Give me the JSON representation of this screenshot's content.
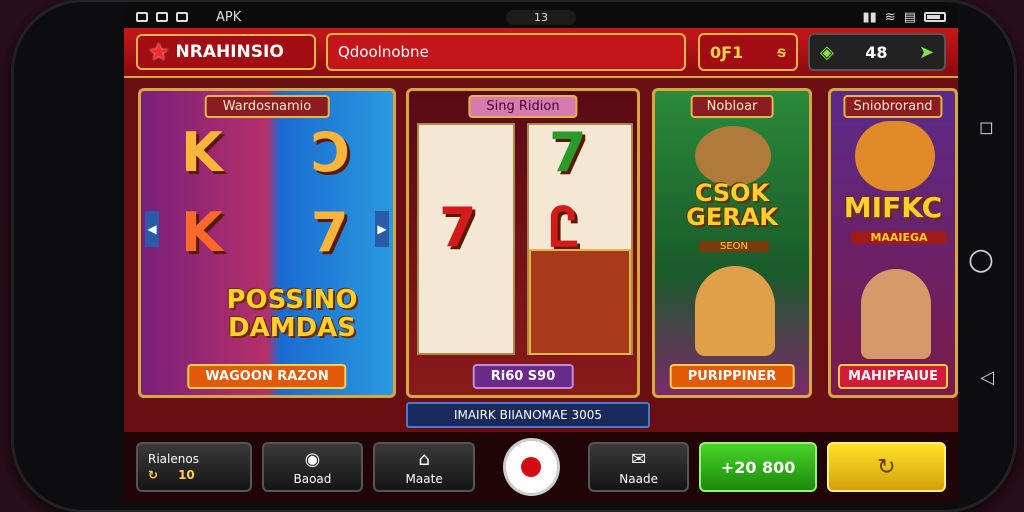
{
  "status": {
    "left_label": "APK",
    "time": "13"
  },
  "header": {
    "logo_text": "NRAHINSIO",
    "search_text": "Qdoolnobne",
    "coins_value": "0Ƒ1",
    "coins_suffix": "ᵴ",
    "gems_value": "48"
  },
  "cards": [
    {
      "title": "Wardosnamio",
      "headline": "POSSINO DAMDAS",
      "footer": "WAGOON RAZON",
      "sym1": "K",
      "sym2": "K",
      "sym3": "Ↄ",
      "sym4": "7"
    },
    {
      "title": "Sing Ridion",
      "headline": "",
      "footer": "Ri60 S90",
      "sym1": "7",
      "sym2": "7",
      "sym3": "Ꮭ"
    },
    {
      "title": "Nobloar",
      "headline": "CSOK GERAK",
      "sub": "SEON",
      "footer": "PURIPPINER"
    },
    {
      "title": "Sniobrorand",
      "headline": "MIFKC",
      "sub": "MAAIEGA",
      "footer": "MAHIPFAIUE"
    }
  ],
  "promo": "IMAIRK BIIANOMAE 3005",
  "bottom": {
    "balance_label": "Rialenos",
    "balance_value": "10",
    "b1": "Baoad",
    "b2": "Maate",
    "b3": "Naade",
    "green_value": "+20 800"
  },
  "colors": {
    "accent": "#c71818",
    "gold": "#e2b64b"
  },
  "icons": [
    "star-icon",
    "wifi-icon",
    "battery-icon",
    "gem-icon",
    "dice-icon",
    "refresh-icon"
  ]
}
